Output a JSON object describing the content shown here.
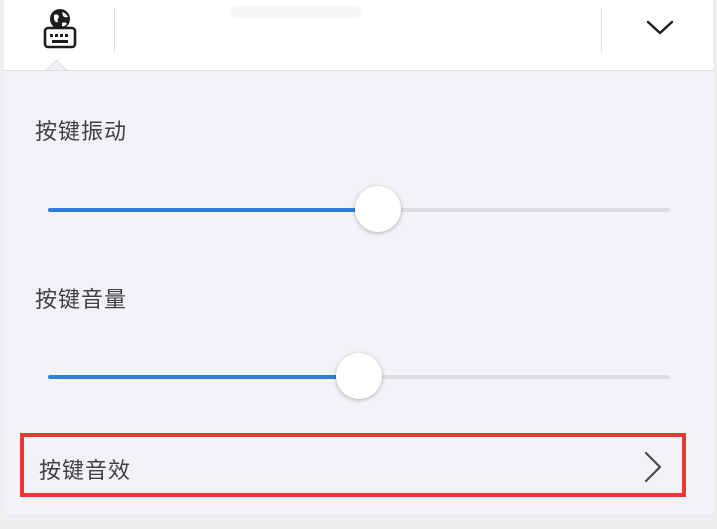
{
  "toolbar": {
    "keyboard_icon": "keyboard-globe-icon",
    "collapse_icon": "chevron-down-icon"
  },
  "settings": {
    "vibration": {
      "label": "按键振动",
      "value_fraction": 0.53
    },
    "volume": {
      "label": "按键音量",
      "value_fraction": 0.5
    },
    "sound_effect": {
      "label": "按键音效",
      "icon": "chevron-right-icon"
    }
  },
  "colors": {
    "accent": "#2f7de1",
    "highlight_border": "#e53935"
  }
}
